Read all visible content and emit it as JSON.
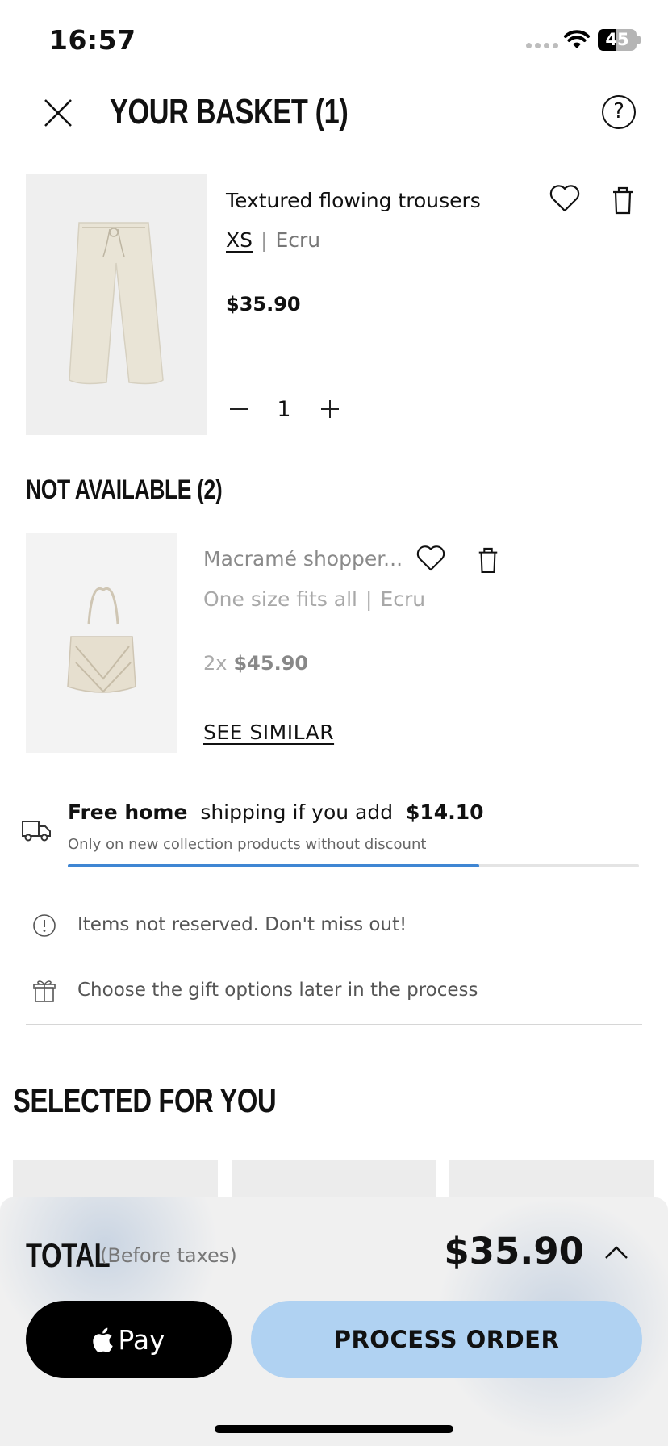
{
  "status_bar": {
    "time": "16:57",
    "battery": "45",
    "battery_level": 0.45
  },
  "header": {
    "title": "YOUR BASKET (1)",
    "help_label": "?"
  },
  "basket_item": {
    "name": "Textured flowing trousers",
    "size": "XS",
    "separator": "|",
    "color": "Ecru",
    "price": "$35.90",
    "quantity": "1"
  },
  "not_available": {
    "title": "NOT AVAILABLE (2)",
    "item": {
      "name": "Macramé shopper...",
      "size": "One size fits all",
      "separator": "|",
      "color": "Ecru",
      "qty": "2x",
      "price": "$45.90",
      "action": "SEE SIMILAR"
    }
  },
  "shipping": {
    "part1": "Free home",
    "part2": "shipping if you add",
    "amount": "$14.10",
    "subtext": "Only on new collection products without discount",
    "progress": 0.72,
    "progress_color": "#3f86d3"
  },
  "notices": [
    {
      "icon": "exclamation-circle-icon",
      "text": "Items not reserved. Don't miss out!"
    },
    {
      "icon": "gift-icon",
      "text": "Choose the gift options later in the process"
    }
  ],
  "recommendations": {
    "title": "SELECTED FOR YOU"
  },
  "footer": {
    "total_label": "TOTAL",
    "total_note": "(Before taxes)",
    "total_amount": "$35.90",
    "apple_pay_label": "Pay",
    "process_label": "PROCESS ORDER",
    "process_color": "#b0d2f2"
  }
}
